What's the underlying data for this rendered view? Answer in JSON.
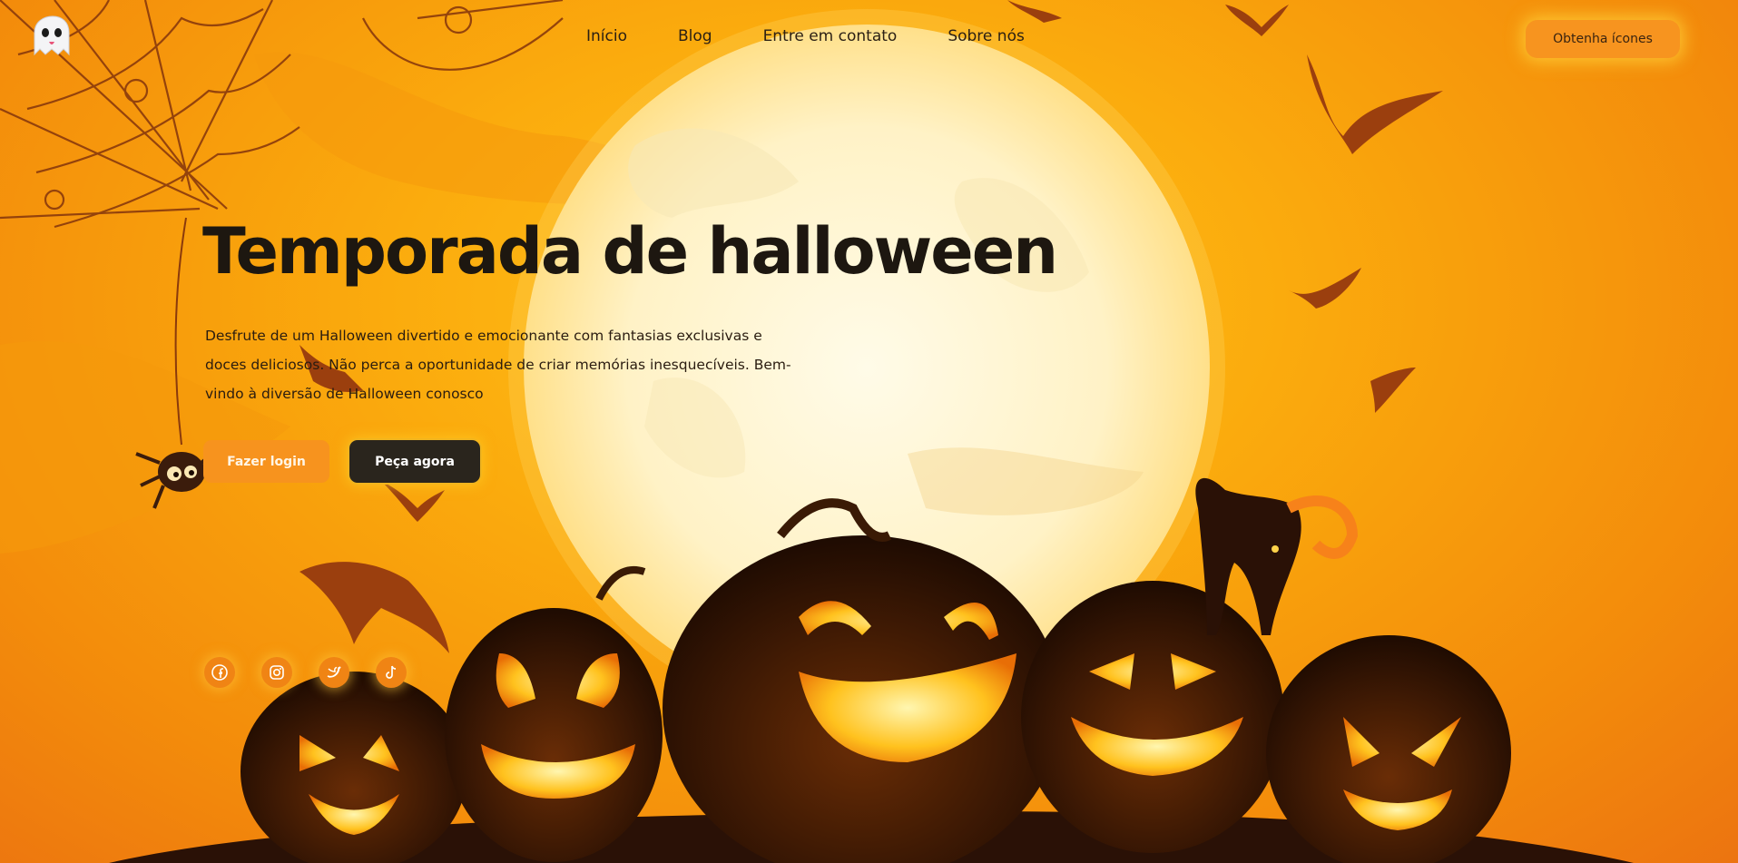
{
  "header": {
    "logo_icon": "ghost-emoji-icon",
    "nav": [
      {
        "label": "Início"
      },
      {
        "label": "Blog"
      },
      {
        "label": "Entre em contato"
      },
      {
        "label": "Sobre nós"
      }
    ],
    "cta_label": "Obtenha ícones"
  },
  "hero": {
    "title": "Temporada de halloween",
    "description": "Desfrute de um Halloween divertido e emocionante com fantasias exclusivas e doces deliciosos. Não perca a oportunidade de criar memórias inesquecíveis. Bem-vindo à diversão de Halloween conosco",
    "login_label": "Fazer login",
    "order_label": "Peça agora"
  },
  "social": [
    {
      "icon": "facebook-icon"
    },
    {
      "icon": "instagram-icon"
    },
    {
      "icon": "twitter-icon"
    },
    {
      "icon": "tiktok-icon"
    }
  ],
  "colors": {
    "background": "#fbab0d",
    "accent": "#f7931e",
    "dark": "#2a251d",
    "moon": "#fff6dc",
    "pumpkin": "#3a1a05"
  }
}
